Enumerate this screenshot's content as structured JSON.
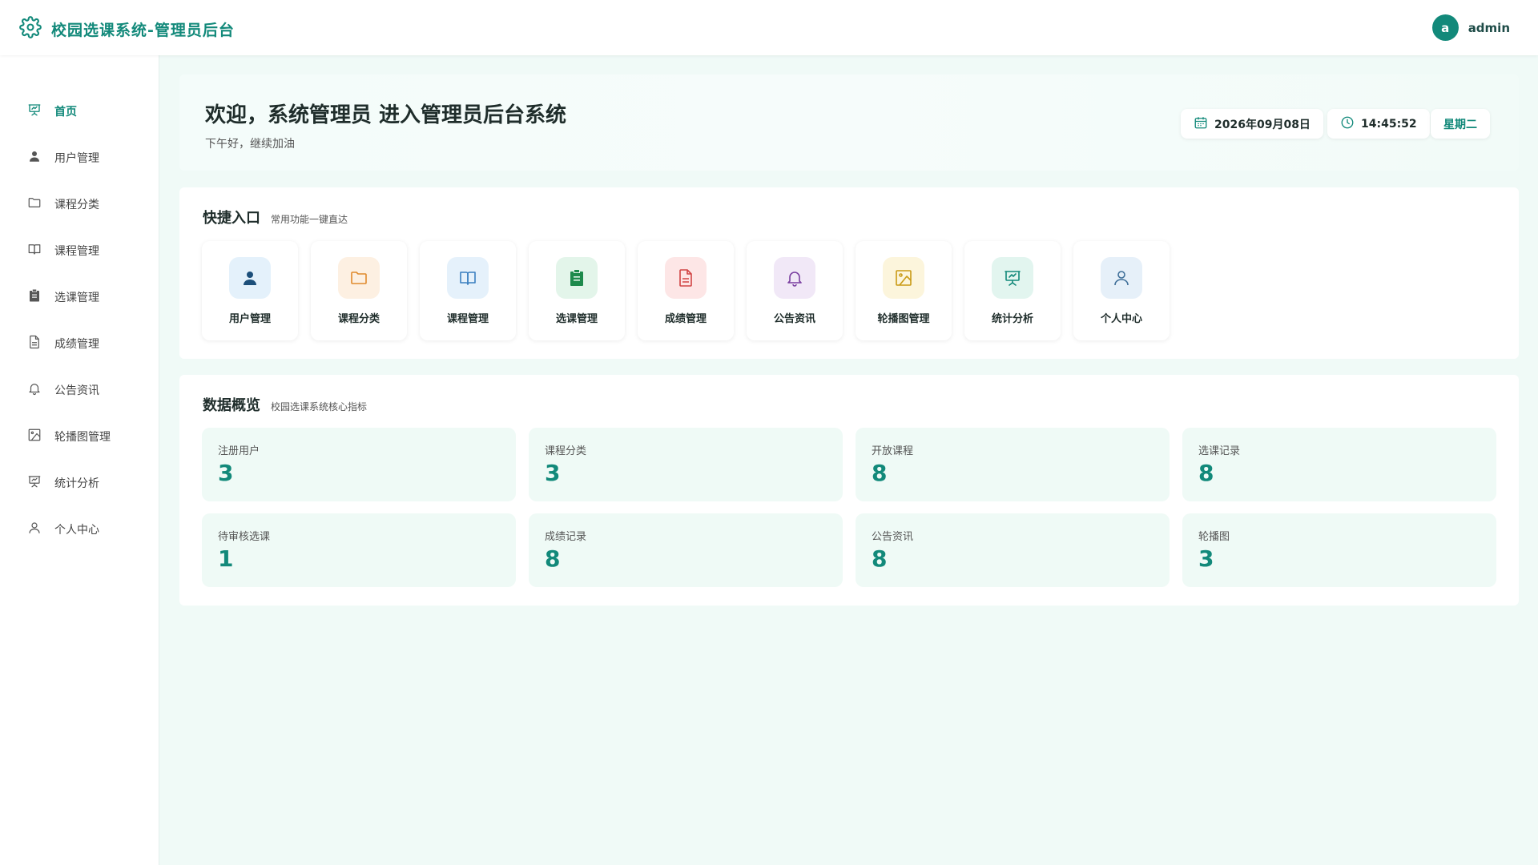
{
  "app": {
    "title": "校园选课系统-管理员后台",
    "avatar_letter": "a",
    "username": "admin",
    "accent_color": "#12897a"
  },
  "sidebar": {
    "items": [
      {
        "label": "首页",
        "icon": "presentation-icon",
        "active": true
      },
      {
        "label": "用户管理",
        "icon": "user-filled-icon"
      },
      {
        "label": "课程分类",
        "icon": "folder-icon"
      },
      {
        "label": "课程管理",
        "icon": "book-icon"
      },
      {
        "label": "选课管理",
        "icon": "clipboard-icon"
      },
      {
        "label": "成绩管理",
        "icon": "document-icon"
      },
      {
        "label": "公告资讯",
        "icon": "bell-icon"
      },
      {
        "label": "轮播图管理",
        "icon": "picture-icon"
      },
      {
        "label": "统计分析",
        "icon": "presentation-icon"
      },
      {
        "label": "个人中心",
        "icon": "user-outline-icon"
      }
    ]
  },
  "welcome": {
    "title": "欢迎，系统管理员 进入管理员后台系统",
    "subtitle": "下午好，继续加油",
    "date": "2026年09月08日",
    "time": "14:45:52",
    "weekday": "星期二"
  },
  "quick": {
    "title": "快捷入口",
    "subtitle": "常用功能一键直达",
    "items": [
      {
        "label": "用户管理",
        "icon": "user-filled-icon",
        "bg": "#e4f1fb",
        "color": "#1c4f7a"
      },
      {
        "label": "课程分类",
        "icon": "folder-icon",
        "bg": "#fdf0e2",
        "color": "#e08a2c"
      },
      {
        "label": "课程管理",
        "icon": "book-icon",
        "bg": "#e5f1fb",
        "color": "#3a7fc0"
      },
      {
        "label": "选课管理",
        "icon": "clipboard-icon",
        "bg": "#e3f5ea",
        "color": "#1e8a4c"
      },
      {
        "label": "成绩管理",
        "icon": "document-icon",
        "bg": "#fde6e6",
        "color": "#d24545"
      },
      {
        "label": "公告资讯",
        "icon": "bell-icon",
        "bg": "#f1e8f7",
        "color": "#7a3ea0"
      },
      {
        "label": "轮播图管理",
        "icon": "picture-icon",
        "bg": "#fcf5dc",
        "color": "#c99a14"
      },
      {
        "label": "统计分析",
        "icon": "presentation-icon",
        "bg": "#e2f5ef",
        "color": "#12897a"
      },
      {
        "label": "个人中心",
        "icon": "user-outline-icon",
        "bg": "#e6f0f9",
        "color": "#3f6f99"
      }
    ]
  },
  "overview": {
    "title": "数据概览",
    "subtitle": "校园选课系统核心指标",
    "stats": [
      {
        "label": "注册用户",
        "value": "3"
      },
      {
        "label": "课程分类",
        "value": "3"
      },
      {
        "label": "开放课程",
        "value": "8"
      },
      {
        "label": "选课记录",
        "value": "8"
      },
      {
        "label": "待审核选课",
        "value": "1"
      },
      {
        "label": "成绩记录",
        "value": "8"
      },
      {
        "label": "公告资讯",
        "value": "8"
      },
      {
        "label": "轮播图",
        "value": "3"
      }
    ]
  }
}
